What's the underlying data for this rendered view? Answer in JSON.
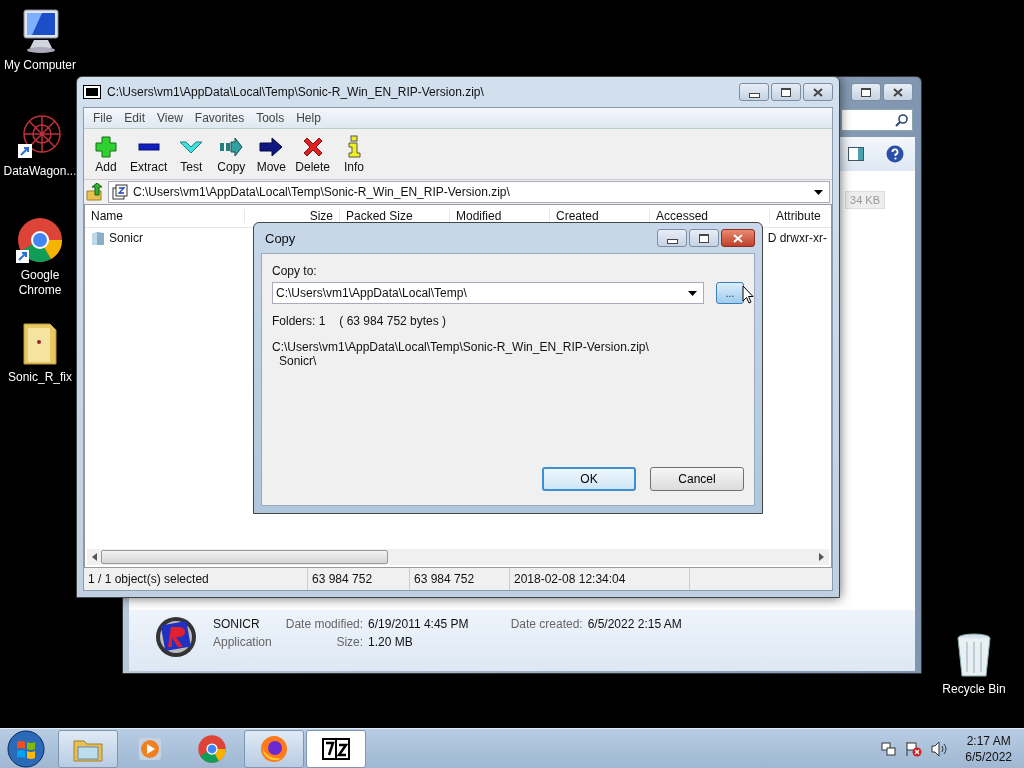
{
  "desktop_icons": [
    {
      "label": "My Computer",
      "kind": "computer"
    },
    {
      "label": "DataWagon...",
      "kind": "artwork"
    },
    {
      "label": "Google Chrome",
      "kind": "chrome"
    },
    {
      "label": "Sonic_R_fix",
      "kind": "folder"
    }
  ],
  "recycle_bin": {
    "label": "Recycle Bin"
  },
  "explorer": {
    "size_badge": "34 KB",
    "details": {
      "name": "SONICR",
      "type": "Application",
      "date_modified_label": "Date modified:",
      "date_modified": "6/19/2011 4:45 PM",
      "size_label": "Size:",
      "size": "1.20 MB",
      "date_created_label": "Date created:",
      "date_created": "6/5/2022 2:15 AM"
    }
  },
  "archive_window": {
    "title": "C:\\Users\\vm1\\AppData\\Local\\Temp\\Sonic-R_Win_EN_RIP-Version.zip\\",
    "menu": [
      "File",
      "Edit",
      "View",
      "Favorites",
      "Tools",
      "Help"
    ],
    "toolbar": [
      {
        "label": "Add",
        "kind": "add"
      },
      {
        "label": "Extract",
        "kind": "extract"
      },
      {
        "label": "Test",
        "kind": "test"
      },
      {
        "label": "Copy",
        "kind": "copy"
      },
      {
        "label": "Move",
        "kind": "move"
      },
      {
        "label": "Delete",
        "kind": "delete"
      },
      {
        "label": "Info",
        "kind": "info"
      }
    ],
    "address": "C:\\Users\\vm1\\AppData\\Local\\Temp\\Sonic-R_Win_EN_RIP-Version.zip\\",
    "columns": [
      "Name",
      "Size",
      "Packed Size",
      "Modified",
      "Created",
      "Accessed",
      "Attribute"
    ],
    "rows": [
      {
        "name": "Sonicr",
        "attributes": "D drwxr-xr-"
      }
    ],
    "status": [
      "1 / 1 object(s) selected",
      "63 984 752",
      "63 984 752",
      "2018-02-08 12:34:04"
    ]
  },
  "dialog": {
    "title": "Copy",
    "copy_to_label": "Copy to:",
    "destination": "C:\\Users\\vm1\\AppData\\Local\\Temp\\",
    "browse": "...",
    "folders": "Folders: 1",
    "bytes": "( 63 984 752 bytes )",
    "source": [
      "C:\\Users\\vm1\\AppData\\Local\\Temp\\Sonic-R_Win_EN_RIP-Version.zip\\",
      "Sonicr\\"
    ],
    "buttons": [
      {
        "label": "OK",
        "default": true
      },
      {
        "label": "Cancel",
        "default": false
      }
    ]
  },
  "taskbar": {
    "apps": [
      {
        "kind": "explorer",
        "open": true
      },
      {
        "kind": "media",
        "open": false
      },
      {
        "kind": "chrome",
        "open": false
      },
      {
        "kind": "firefox",
        "open": true
      },
      {
        "kind": "sevenzip",
        "open": true
      }
    ],
    "time": "2:17 AM",
    "date": "6/5/2022"
  }
}
